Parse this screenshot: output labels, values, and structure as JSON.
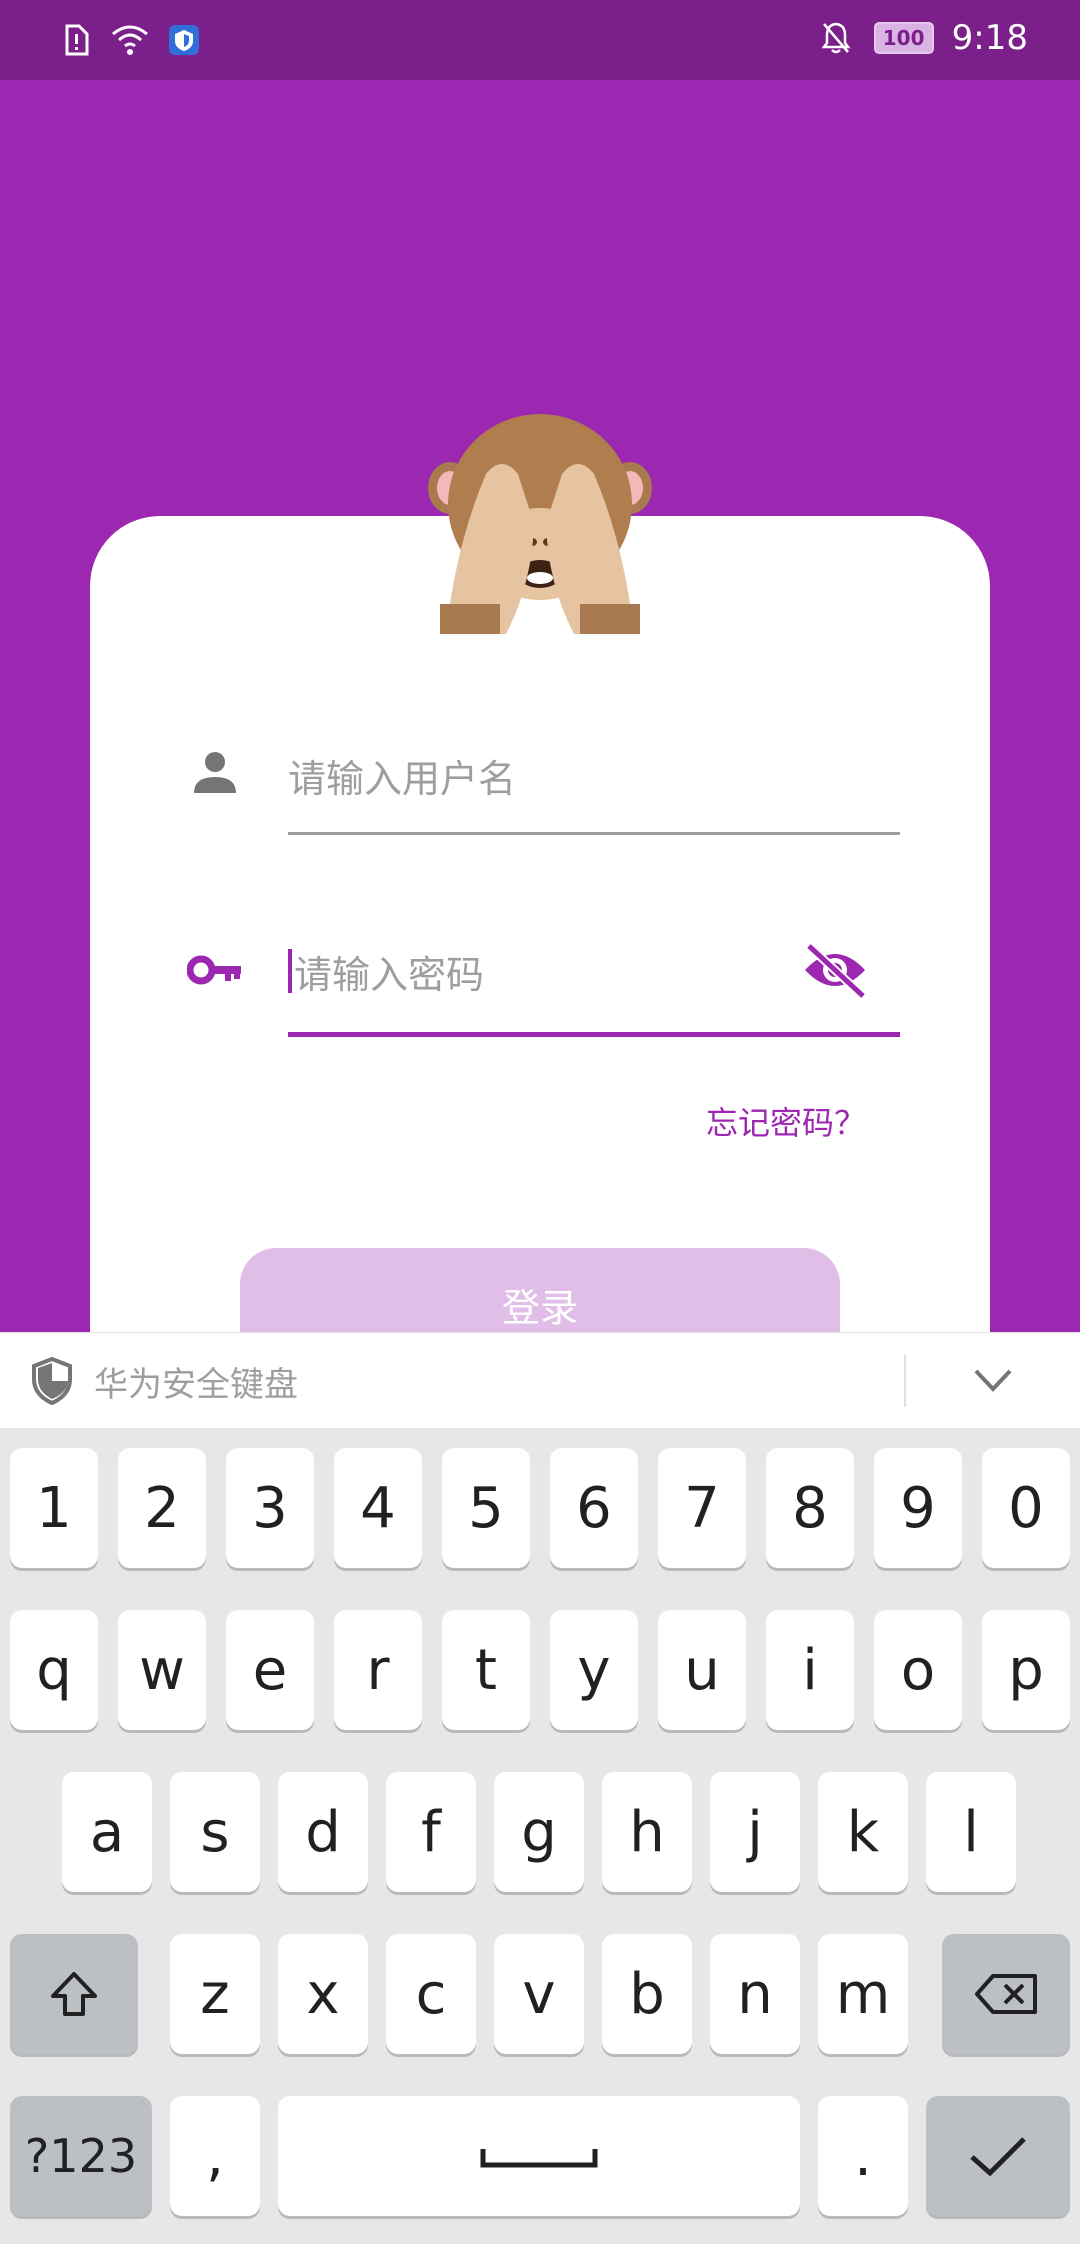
{
  "status_bar": {
    "time": "9:18",
    "battery": "100",
    "icons": [
      "sim-alert-icon",
      "wifi-icon",
      "shield-app-icon",
      "notifications-off-icon",
      "battery-icon"
    ]
  },
  "login": {
    "avatar_icon": "see-no-evil-monkey",
    "username_placeholder": "请输入用户名",
    "password_placeholder": "请输入密码",
    "forgot_password": "忘记密码？",
    "login_button": "登录",
    "accent_color": "#9c27b0",
    "background_color": "#9c27b0"
  },
  "keyboard": {
    "title": "华为安全键盘",
    "numbers": [
      "1",
      "2",
      "3",
      "4",
      "5",
      "6",
      "7",
      "8",
      "9",
      "0"
    ],
    "row1": [
      "q",
      "w",
      "e",
      "r",
      "t",
      "y",
      "u",
      "i",
      "o",
      "p"
    ],
    "row2": [
      "a",
      "s",
      "d",
      "f",
      "g",
      "h",
      "j",
      "k",
      "l"
    ],
    "row3": [
      "z",
      "x",
      "c",
      "v",
      "b",
      "n",
      "m"
    ],
    "symbols_key": "?123",
    "comma": ",",
    "period": "."
  }
}
